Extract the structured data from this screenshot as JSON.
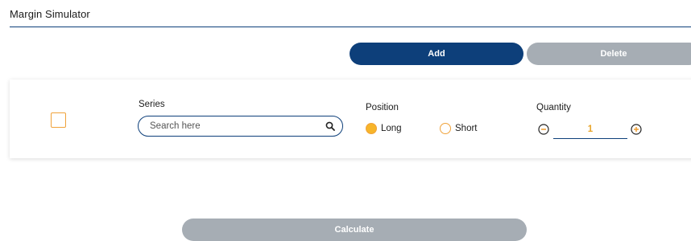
{
  "header": {
    "title": "Margin Simulator"
  },
  "toolbar": {
    "add_label": "Add",
    "delete_label": "Delete"
  },
  "row": {
    "series": {
      "label": "Series",
      "placeholder": "Search here",
      "value": "",
      "icon": "search-icon"
    },
    "position": {
      "label": "Position",
      "options": [
        {
          "label": "Long",
          "selected": true
        },
        {
          "label": "Short",
          "selected": false
        }
      ]
    },
    "quantity": {
      "label": "Quantity",
      "value": "1",
      "decrement_icon": "minus-circle-icon",
      "increment_icon": "plus-circle-icon"
    },
    "checkbox": {
      "checked": false
    }
  },
  "footer": {
    "calculate_label": "Calculate"
  },
  "colors": {
    "primary": "#0d3f7a",
    "disabled": "#a6adb4",
    "accent": "#f0a23a"
  }
}
